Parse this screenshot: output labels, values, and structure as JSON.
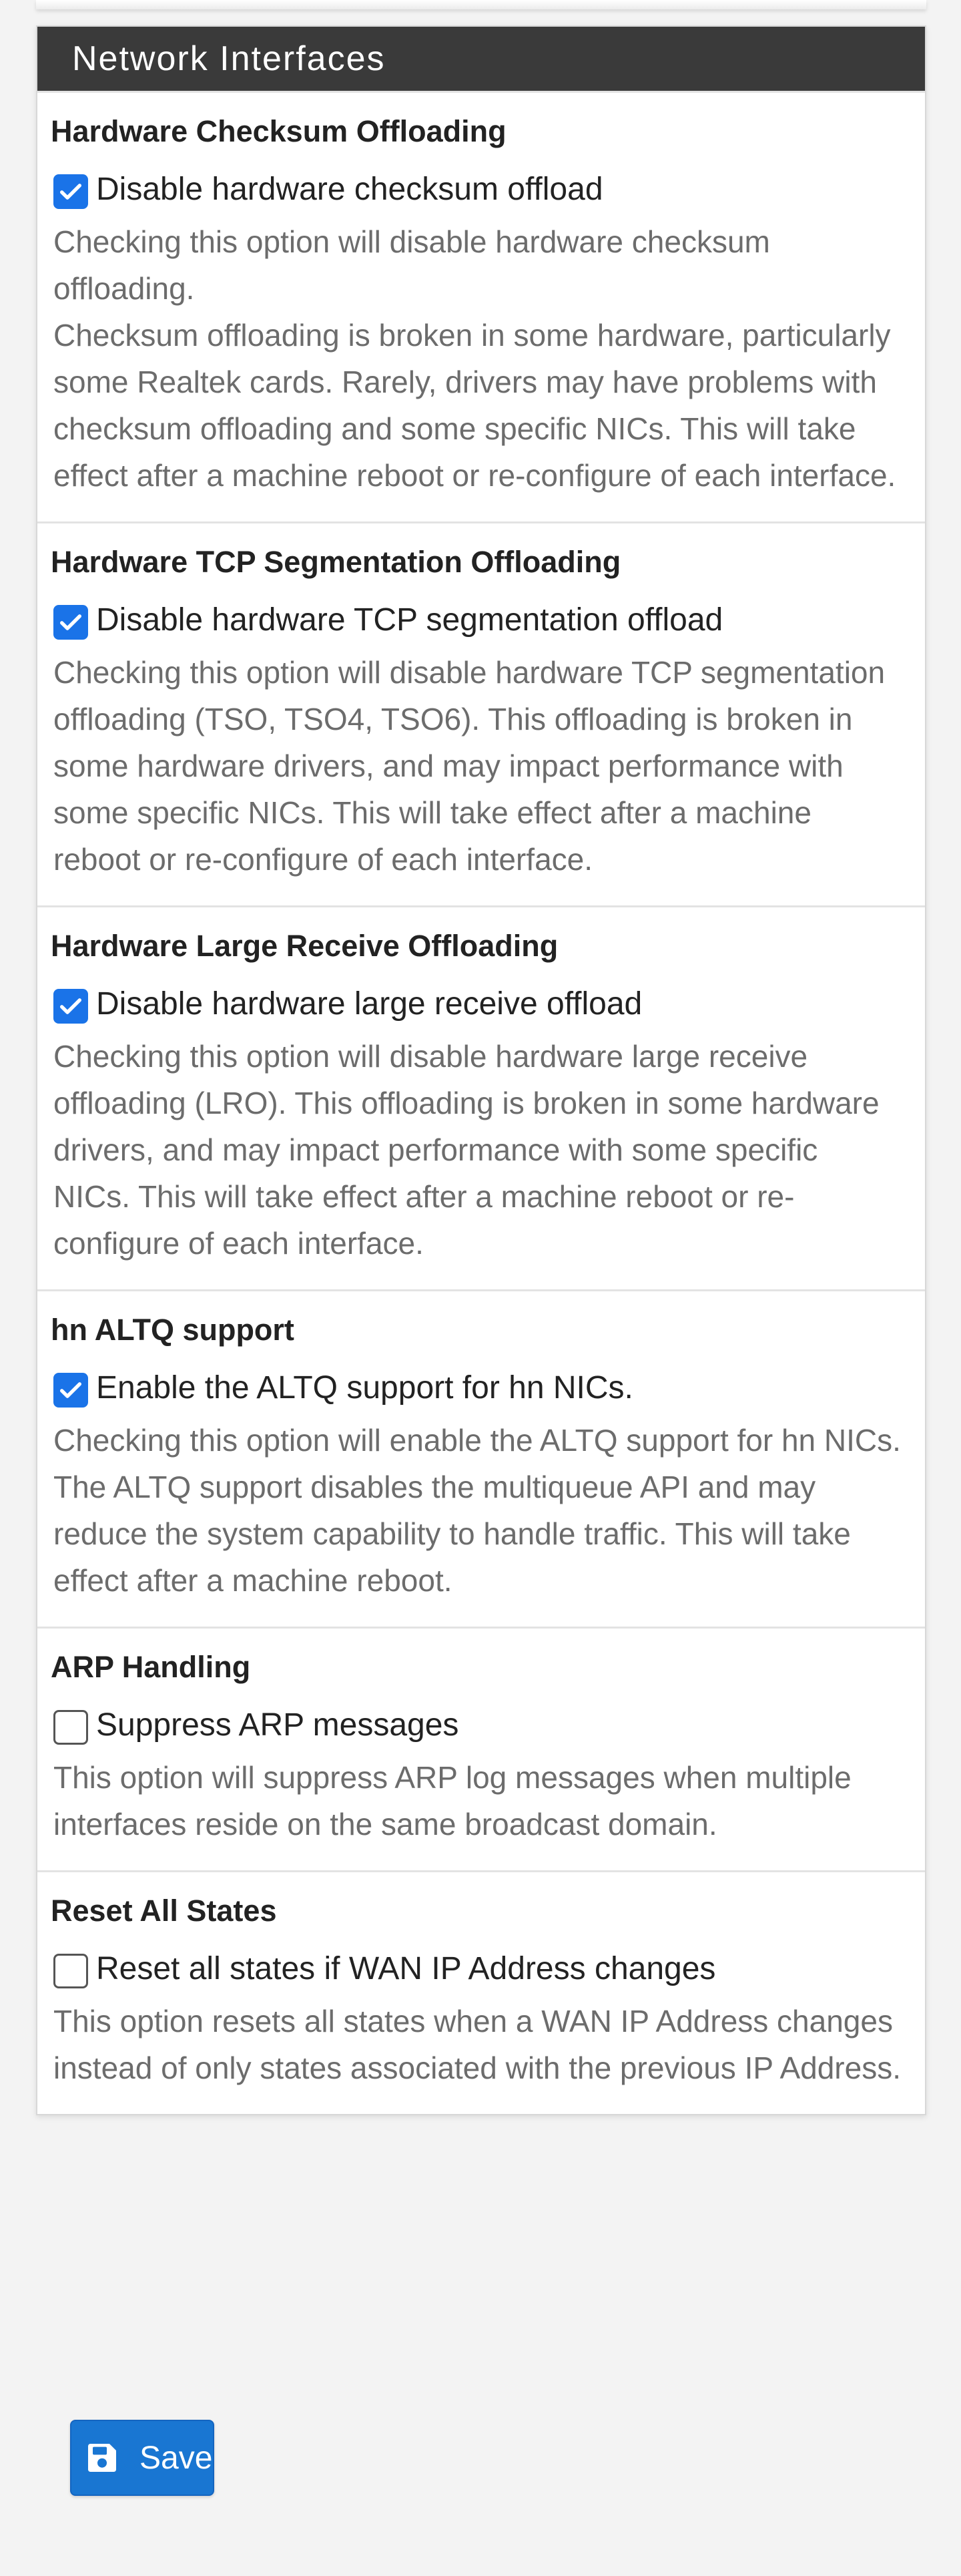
{
  "panel": {
    "title": "Network Interfaces"
  },
  "sections": [
    {
      "title": "Hardware Checksum Offloading",
      "checkbox_label": "Disable hardware checksum offload",
      "checked": true,
      "help_lines": [
        "Checking this option will disable hardware checksum offloading.",
        "Checksum offloading is broken in some hardware, particularly some Realtek cards. Rarely, drivers may have problems with checksum offloading and some specific NICs. This will take effect after a machine reboot or re-configure of each interface."
      ]
    },
    {
      "title": "Hardware TCP Segmentation Offloading",
      "checkbox_label": "Disable hardware TCP segmentation offload",
      "checked": true,
      "help_lines": [
        "Checking this option will disable hardware TCP segmentation offloading (TSO, TSO4, TSO6). This offloading is broken in some hardware drivers, and may impact performance with some specific NICs. This will take effect after a machine reboot or re-configure of each interface."
      ]
    },
    {
      "title": "Hardware Large Receive Offloading",
      "checkbox_label": "Disable hardware large receive offload",
      "checked": true,
      "help_lines": [
        "Checking this option will disable hardware large receive offloading (LRO). This offloading is broken in some hardware drivers, and may impact performance with some specific NICs. This will take effect after a machine reboot or re-configure of each interface."
      ]
    },
    {
      "title": "hn ALTQ support",
      "checkbox_label": "Enable the ALTQ support for hn NICs.",
      "checked": true,
      "help_lines": [
        "Checking this option will enable the ALTQ support for hn NICs. The ALTQ support disables the multiqueue API and may reduce the system capability to handle traffic. This will take effect after a machine reboot."
      ]
    },
    {
      "title": "ARP Handling",
      "checkbox_label": "Suppress ARP messages",
      "checked": false,
      "help_lines": [
        "This option will suppress ARP log messages when multiple interfaces reside on the same broadcast domain."
      ]
    },
    {
      "title": "Reset All States",
      "checkbox_label": "Reset all states if WAN IP Address changes",
      "checked": false,
      "help_lines": [
        "This option resets all states when a WAN IP Address changes instead of only states associated with the previous IP Address."
      ]
    }
  ],
  "save_button": {
    "label": "Save",
    "icon": "floppy-disk-icon"
  },
  "colors": {
    "heading_bg": "#3a3a3a",
    "accent_blue": "#1a73e8",
    "button_blue": "#1976d2",
    "help_text": "#6c6c6c"
  }
}
